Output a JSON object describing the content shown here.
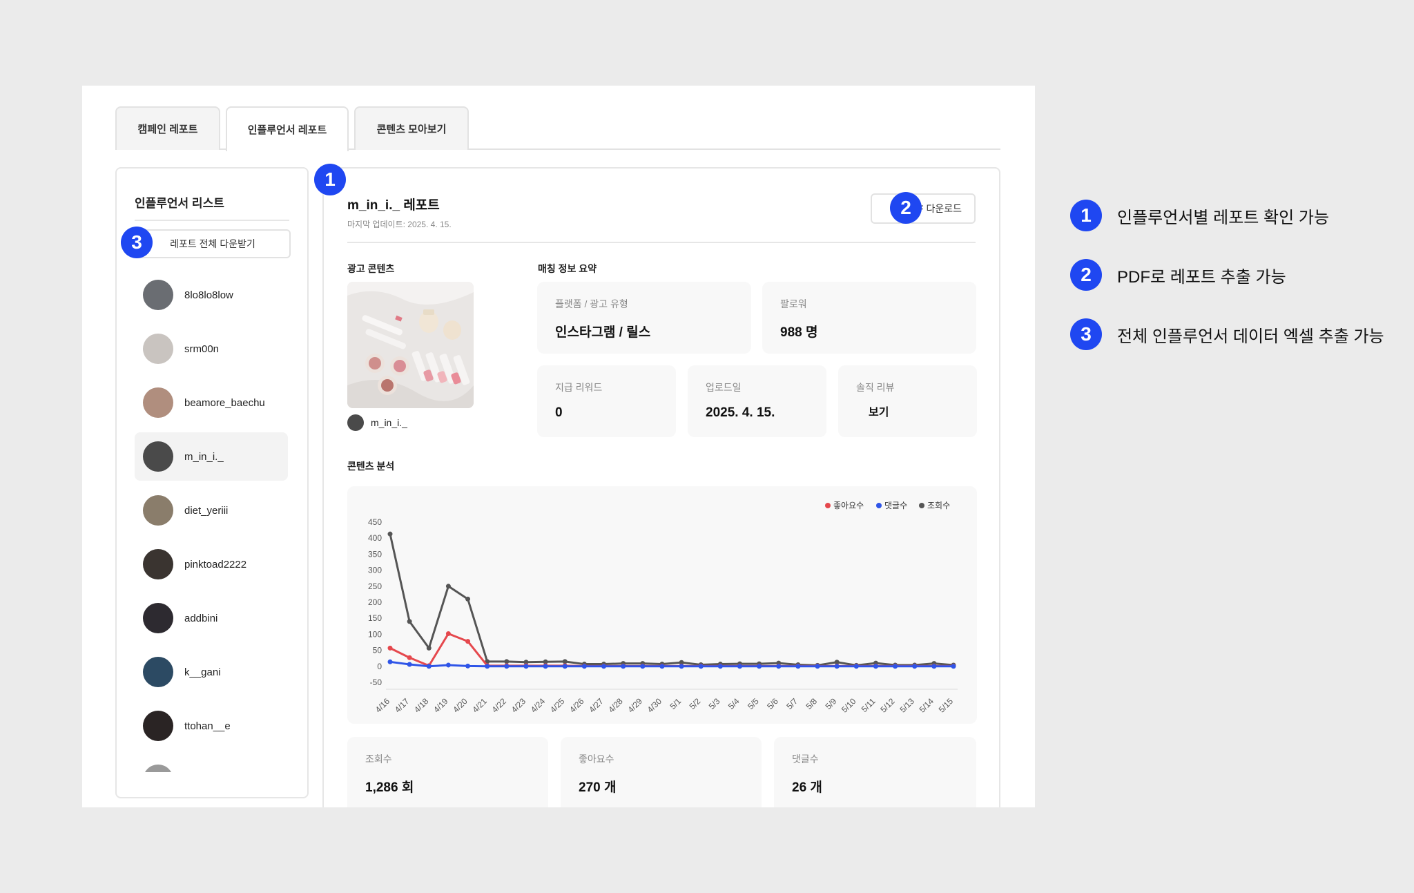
{
  "tabs": [
    {
      "label": "캠페인 레포트",
      "active": false
    },
    {
      "label": "인플루언서 레포트",
      "active": true
    },
    {
      "label": "콘텐츠 모아보기",
      "active": false
    }
  ],
  "sidebar": {
    "title": "인플루언서 리스트",
    "download_all_label": "레포트 전체 다운받기",
    "influencers": [
      {
        "name": "8lo8lo8low",
        "avatar_color": "#6a6d72"
      },
      {
        "name": "srm00n",
        "avatar_color": "#c9c4c0"
      },
      {
        "name": "beamore_baechu",
        "avatar_color": "#b08e7e"
      },
      {
        "name": "m_in_i._",
        "avatar_color": "#4a4a4a",
        "selected": true
      },
      {
        "name": "diet_yeriii",
        "avatar_color": "#8a7d6b"
      },
      {
        "name": "pinktoad2222",
        "avatar_color": "#3a3430"
      },
      {
        "name": "addbini",
        "avatar_color": "#2d2a30"
      },
      {
        "name": "k__gani",
        "avatar_color": "#2c4a63"
      },
      {
        "name": "ttohan__e",
        "avatar_color": "#2a2424"
      },
      {
        "name": "",
        "avatar_color": "#9a9a9a"
      }
    ]
  },
  "report": {
    "title": "m_in_i._ 레포트",
    "updated": "마지막 업데이트: 2025. 4. 15.",
    "pdf_label": "PDF 다운로드",
    "ad_content_label": "광고 콘텐츠",
    "ad_content_user": "m_in_i._",
    "matching_label": "매칭 정보 요약",
    "cards": {
      "platform": {
        "label": "플랫폼 / 광고 유형",
        "value": "인스타그램 / 릴스"
      },
      "followers": {
        "label": "팔로워",
        "value": "988 명"
      },
      "reward": {
        "label": "지급 리워드",
        "value": "0"
      },
      "upload": {
        "label": "업로드일",
        "value": "2025. 4. 15."
      },
      "review": {
        "label": "솔직 리뷰",
        "value": "보기"
      }
    },
    "analysis_label": "콘텐츠 분석",
    "stats": {
      "views": {
        "label": "조회수",
        "value": "1,286 회"
      },
      "likes": {
        "label": "좋아요수",
        "value": "270 개"
      },
      "comments": {
        "label": "댓글수",
        "value": "26 개"
      }
    }
  },
  "badges": {
    "one": "1",
    "two": "2",
    "three": "3"
  },
  "annotations": [
    {
      "num": "1",
      "text": "인플루언서별 레포트 확인 가능"
    },
    {
      "num": "2",
      "text": "PDF로 레포트 추출 가능"
    },
    {
      "num": "3",
      "text": "전체 인플루언서 데이터 엑셀 추출 가능"
    }
  ],
  "colors": {
    "accent": "#1f47f1",
    "likes": "#e5484d",
    "comments": "#2f55e8",
    "views": "#555555"
  },
  "chart_data": {
    "type": "line",
    "categories": [
      "4/16",
      "4/17",
      "4/18",
      "4/19",
      "4/20",
      "4/21",
      "4/22",
      "4/23",
      "4/24",
      "4/25",
      "4/26",
      "4/27",
      "4/28",
      "4/29",
      "4/30",
      "5/1",
      "5/2",
      "5/3",
      "5/4",
      "5/5",
      "5/6",
      "5/7",
      "5/8",
      "5/9",
      "5/10",
      "5/11",
      "5/12",
      "5/13",
      "5/14",
      "5/15"
    ],
    "y_ticks": [
      450,
      400,
      350,
      300,
      250,
      200,
      150,
      100,
      50,
      0,
      -50
    ],
    "ylim": [
      -50,
      450
    ],
    "legend_position": "top-right",
    "grid": false,
    "series": [
      {
        "name": "좋아요수",
        "color": "#e5484d",
        "values": [
          57,
          27,
          2,
          102,
          78,
          2,
          2,
          2,
          2,
          2,
          1,
          1,
          1,
          1,
          1,
          1,
          1,
          1,
          1,
          1,
          1,
          1,
          1,
          1,
          1,
          1,
          1,
          1,
          1,
          1
        ]
      },
      {
        "name": "댓글수",
        "color": "#2f55e8",
        "values": [
          14,
          6,
          0,
          4,
          1,
          0,
          0,
          0,
          0,
          0,
          0,
          0,
          0,
          0,
          0,
          0,
          0,
          0,
          0,
          0,
          0,
          0,
          0,
          0,
          0,
          0,
          0,
          0,
          0,
          0
        ]
      },
      {
        "name": "조회수",
        "color": "#555555",
        "values": [
          413,
          140,
          57,
          250,
          210,
          15,
          15,
          13,
          14,
          15,
          7,
          7,
          9,
          9,
          7,
          12,
          5,
          7,
          8,
          8,
          10,
          5,
          3,
          13,
          3,
          10,
          4,
          4,
          9,
          4
        ]
      }
    ]
  }
}
